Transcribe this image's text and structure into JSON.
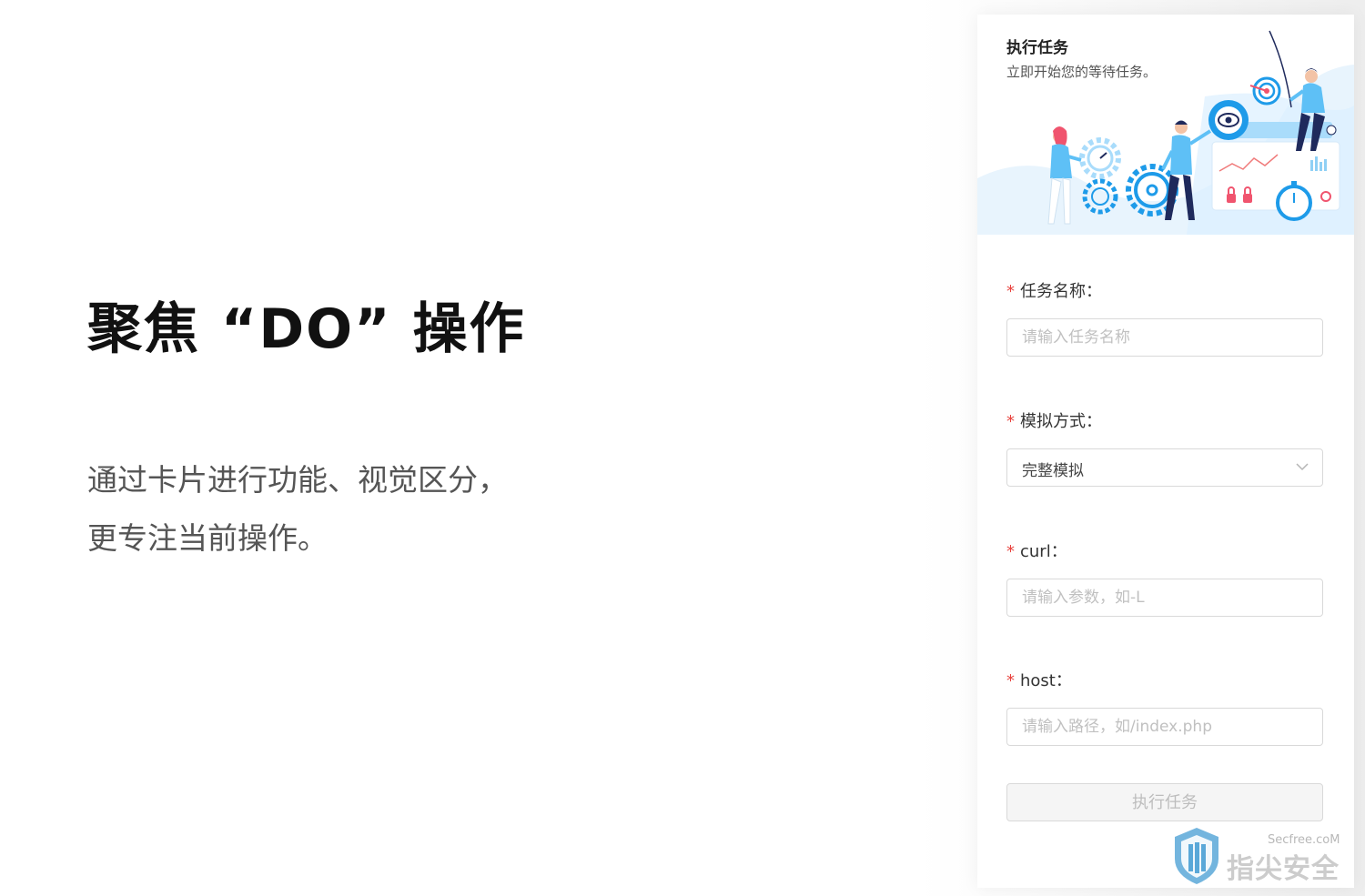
{
  "promo": {
    "headline": "聚焦 “DO” 操作",
    "description_line1": "通过卡片进行功能、视觉区分，",
    "description_line2": "更专注当前操作。"
  },
  "card": {
    "banner": {
      "title": "执行任务",
      "subtitle": "立即开始您的等待任务。"
    },
    "fields": {
      "task_name": {
        "required_mark": "*",
        "label": "任务名称：",
        "placeholder": "请输入任务名称"
      },
      "simulation_mode": {
        "required_mark": "*",
        "label": "模拟方式：",
        "value": "完整模拟"
      },
      "curl": {
        "required_mark": "*",
        "label": "curl：",
        "placeholder": "请输入参数，如-L"
      },
      "host": {
        "required_mark": "*",
        "label": "host：",
        "placeholder": "请输入路径，如/index.php"
      }
    },
    "submit_label": "执行任务"
  },
  "watermark": {
    "site": "Secfree.coM",
    "brand": "指尖安全"
  },
  "colors": {
    "required": "#e8413c",
    "illustration_blue": "#1e9be9",
    "dark_navy": "#1f2a5c",
    "disabled_bg": "#f5f5f5"
  }
}
